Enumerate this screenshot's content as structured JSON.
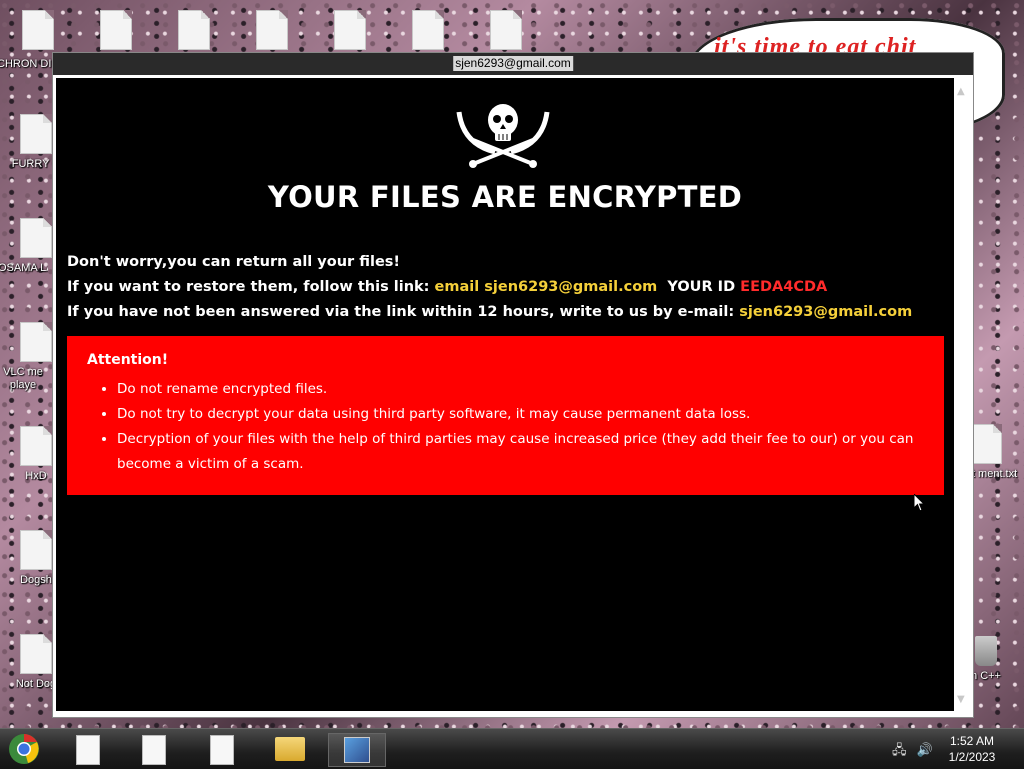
{
  "desktop": {
    "left_icons": [
      "CHRON DISEA",
      "FURRY C",
      "OSAMA LADEN E",
      "VLC me playe",
      "HxD",
      "Dogsh",
      "Not Dog"
    ],
    "top_icons_count": 7,
    "right_icons": [
      "Text ment.txt",
      "n C++"
    ],
    "bubble_text": "it's time to eat chit",
    "bubble_fragment": "te"
  },
  "window": {
    "title": "sjen6293@gmail.com",
    "heading": "YOUR FILES ARE ENCRYPTED",
    "line1": "Don't worry,you can return all your files!",
    "line2_prefix": "If you want to restore them, follow this link:",
    "line2_email": "email sjen6293@gmail.com",
    "line2_id_label": "YOUR ID",
    "line2_id": "EEDA4CDA",
    "line3_prefix": "If you have not been answered via the link within 12 hours, write to us by e-mail:",
    "line3_email": "sjen6293@gmail.com",
    "attention": {
      "heading": "Attention!",
      "items": [
        "Do not rename encrypted files.",
        "Do not try to decrypt your data using third party software, it may cause permanent data loss.",
        "Decryption of your files with the help of third parties may cause increased price (they add their fee to our) or you can become a victim of a scam."
      ]
    }
  },
  "taskbar": {
    "time": "1:52 AM",
    "date": "1/2/2023"
  },
  "colors": {
    "accent_yellow": "#f5d03a",
    "id_red": "#ff2b2b",
    "attention_bg": "#ff0000"
  }
}
